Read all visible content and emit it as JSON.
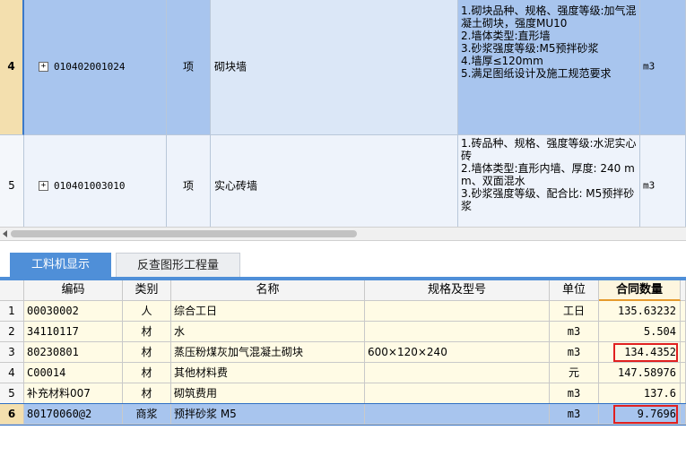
{
  "upper_table": {
    "rows": [
      {
        "index": "4",
        "expand": "+",
        "code": "010402001024",
        "category": "项",
        "name": "砌块墙",
        "spec": "1.砌块品种、规格、强度等级:加气混凝土砌块，强度MU10\n2.墙体类型:直形墙\n3.砂浆强度等级:M5预拌砂浆\n4.墙厚≤120mm\n5.满足图纸设计及施工规范要求",
        "unit": "m3"
      },
      {
        "index": "5",
        "expand": "+",
        "code": "010401003010",
        "category": "项",
        "name": "实心砖墙",
        "spec": "1.砖品种、规格、强度等级:水泥实心砖\n2.墙体类型:直形内墙、厚度: 240 mm、双面混水\n3.砂浆强度等级、配合比: M5预拌砂浆",
        "unit": "m3"
      }
    ]
  },
  "tabs": {
    "active": "工料机显示",
    "inactive": "反查图形工程量"
  },
  "lower_table": {
    "headers": {
      "code": "编码",
      "category": "类别",
      "name": "名称",
      "spec": "规格及型号",
      "unit": "单位",
      "qty": "合同数量"
    },
    "rows": [
      {
        "index": "1",
        "code": "00030002",
        "category": "人",
        "name": "综合工日",
        "spec": "",
        "unit": "工日",
        "qty": "135.63232"
      },
      {
        "index": "2",
        "code": "34110117",
        "category": "材",
        "name": "水",
        "spec": "",
        "unit": "m3",
        "qty": "5.504"
      },
      {
        "index": "3",
        "code": "80230801",
        "category": "材",
        "name": "蒸压粉煤灰加气混凝土砌块",
        "spec": "600×120×240",
        "unit": "m3",
        "qty": "134.4352"
      },
      {
        "index": "4",
        "code": "C00014",
        "category": "材",
        "name": "其他材料费",
        "spec": "",
        "unit": "元",
        "qty": "147.58976"
      },
      {
        "index": "5",
        "code": "补充材料007",
        "category": "材",
        "name": "砌筑费用",
        "spec": "",
        "unit": "m3",
        "qty": "137.6"
      },
      {
        "index": "6",
        "code": "80170060@2",
        "category": "商浆",
        "name": "预拌砂浆 M5",
        "spec": "",
        "unit": "m3",
        "qty": "9.7696"
      }
    ]
  },
  "colors": {
    "selected_row": "#a8c5ee",
    "tab_active": "#4f8fd8",
    "highlight_box": "#e02020",
    "row_bg": "#fffbe5"
  }
}
